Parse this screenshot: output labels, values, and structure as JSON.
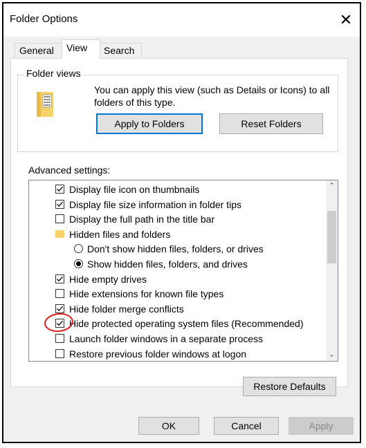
{
  "window": {
    "title": "Folder Options",
    "close_glyph": "✕"
  },
  "tabs": [
    {
      "label": "General",
      "active": false
    },
    {
      "label": "View",
      "active": true
    },
    {
      "label": "Search",
      "active": false
    }
  ],
  "folder_views": {
    "legend": "Folder views",
    "description": "You can apply this view (such as Details or Icons) to all folders of this type.",
    "apply_button": "Apply to Folders",
    "reset_button": "Reset Folders"
  },
  "advanced": {
    "label": "Advanced settings:",
    "items": [
      {
        "kind": "checkbox",
        "label": "Display file icon on thumbnails",
        "checked": true
      },
      {
        "kind": "checkbox",
        "label": "Display file size information in folder tips",
        "checked": true
      },
      {
        "kind": "checkbox",
        "label": "Display the full path in the title bar",
        "checked": false
      },
      {
        "kind": "folder",
        "label": "Hidden files and folders"
      },
      {
        "kind": "radio",
        "label": "Don't show hidden files, folders, or drives",
        "checked": false
      },
      {
        "kind": "radio",
        "label": "Show hidden files, folders, and drives",
        "checked": true
      },
      {
        "kind": "checkbox",
        "label": "Hide empty drives",
        "checked": true
      },
      {
        "kind": "checkbox",
        "label": "Hide extensions for known file types",
        "checked": false
      },
      {
        "kind": "checkbox",
        "label": "Hide folder merge conflicts",
        "checked": true
      },
      {
        "kind": "checkbox",
        "label": "Hide protected operating system files (Recommended)",
        "checked": true
      },
      {
        "kind": "checkbox",
        "label": "Launch folder windows in a separate process",
        "checked": false
      },
      {
        "kind": "checkbox",
        "label": "Restore previous folder windows at logon",
        "checked": false
      }
    ],
    "restore_defaults": "Restore Defaults"
  },
  "footer": {
    "ok": "OK",
    "cancel": "Cancel",
    "apply": "Apply"
  },
  "colors": {
    "annotation": "#e0201d",
    "default_button_border": "#0078d7",
    "folder_icon": "#f6d26b"
  }
}
